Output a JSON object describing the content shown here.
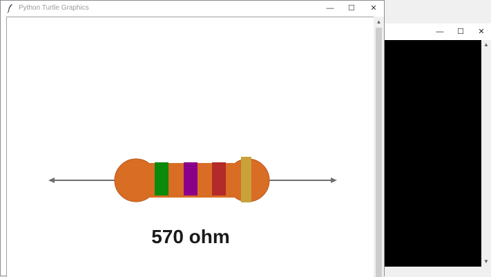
{
  "main_window": {
    "title": "Python Turtle Graphics",
    "controls": {
      "minimize": "—",
      "maximize": "☐",
      "close": "✕"
    }
  },
  "second_window": {
    "controls": {
      "minimize": "—",
      "maximize": "☐",
      "close": "✕"
    }
  },
  "resistor": {
    "label": "570 ohm",
    "colors": {
      "body": "#d96d24",
      "body_outline": "#b5571a",
      "lead": "#6e6e6e",
      "band1": "#0a8a0a",
      "band2": "#8b008b",
      "band3": "#b22a2a",
      "band4": "#c8a23a"
    }
  }
}
